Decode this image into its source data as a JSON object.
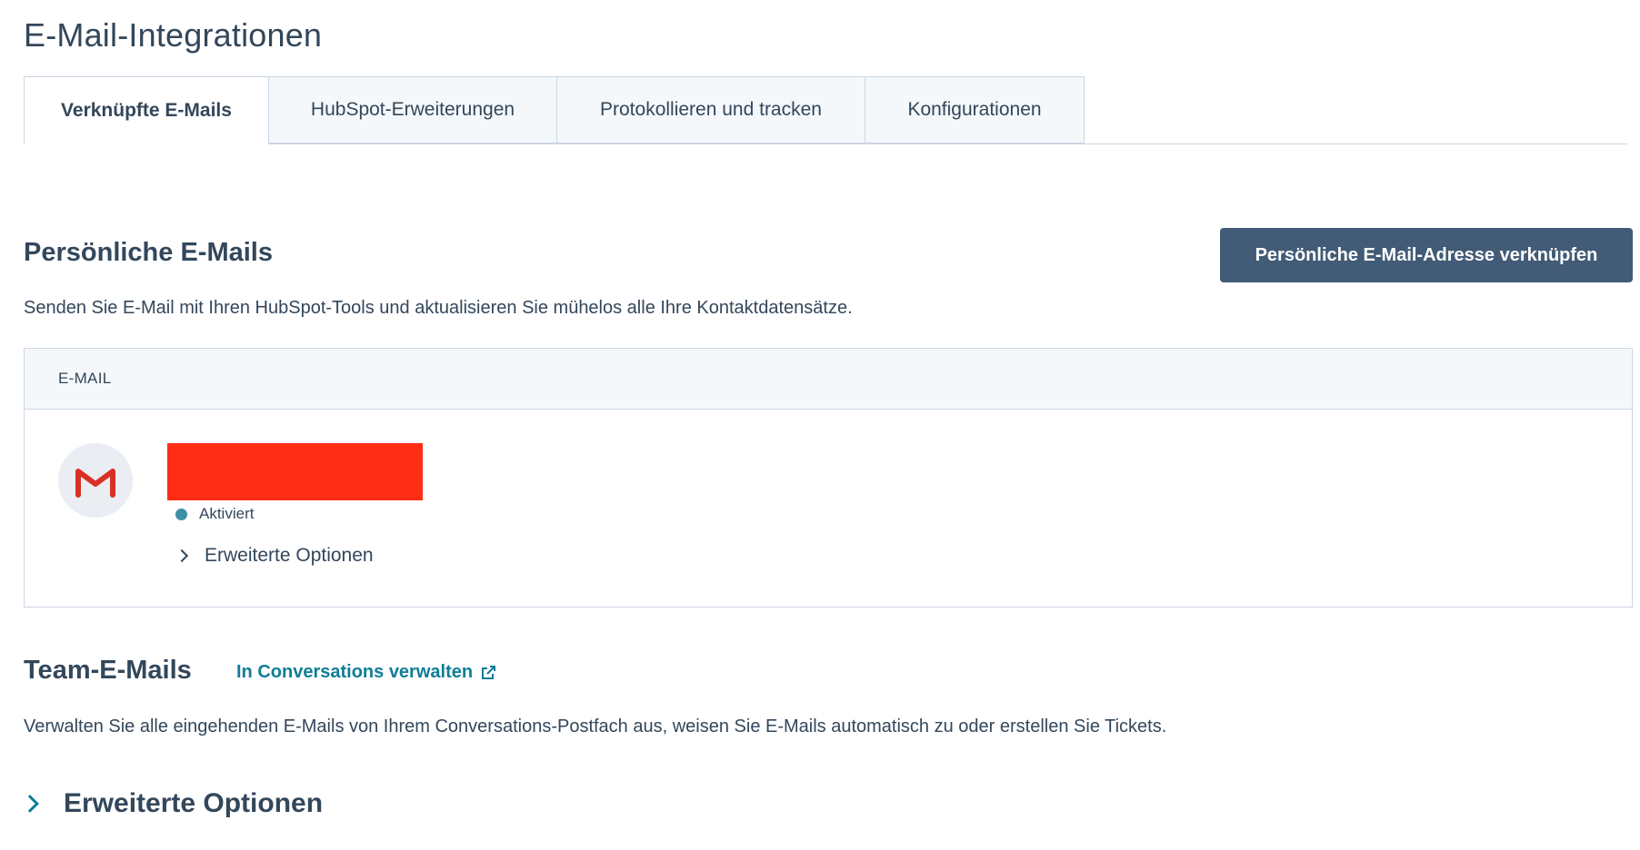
{
  "page": {
    "title": "E-Mail-Integrationen"
  },
  "tabs": [
    {
      "label": "Verknüpfte E-Mails",
      "active": true
    },
    {
      "label": "HubSpot-Erweiterungen",
      "active": false
    },
    {
      "label": "Protokollieren und tracken",
      "active": false
    },
    {
      "label": "Konfigurationen",
      "active": false
    }
  ],
  "personal": {
    "title": "Persönliche E-Mails",
    "button_label": "Persönliche E-Mail-Adresse verknüpfen",
    "description": "Senden Sie E-Mail mit Ihren HubSpot-Tools und aktualisieren Sie mühelos alle Ihre Kontaktdatensätze.",
    "table": {
      "header": "E-MAIL",
      "rows": [
        {
          "provider_icon": "gmail-icon",
          "status": "Aktiviert",
          "advanced_label": "Erweiterte Optionen"
        }
      ]
    }
  },
  "team": {
    "title": "Team-E-Mails",
    "link_label": "In Conversations verwalten",
    "description": "Verwalten Sie alle eingehenden E-Mails von Ihrem Conversations-Postfach aus, weisen Sie E-Mails automatisch zu oder erstellen Sie Tickets."
  },
  "advanced": {
    "label": "Erweiterte Optionen"
  },
  "colors": {
    "text": "#33475b",
    "link": "#0f7d96",
    "button": "#425b76",
    "status_active": "#3e8ea5",
    "redaction": "#ff2d14"
  }
}
